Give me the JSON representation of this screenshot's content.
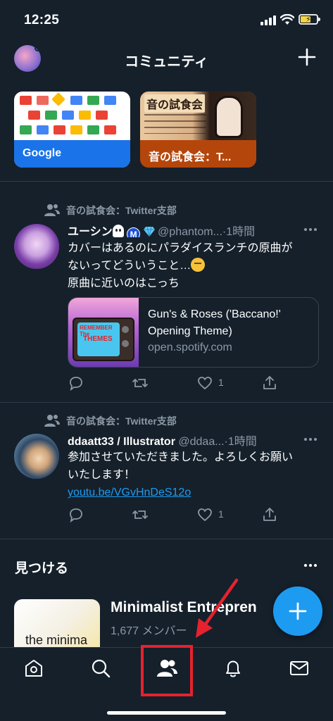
{
  "status_bar": {
    "time": "12:25"
  },
  "header": {
    "title": "コミュニティ"
  },
  "communities": [
    {
      "label": "Google"
    },
    {
      "label": "音の試食会：T...",
      "art_text": "音の試食会"
    }
  ],
  "tweets": [
    {
      "context": "音の試食会：Twitter支部",
      "name": "ユーシン",
      "verified_letter": "M",
      "handle": "@phantom...",
      "sep": "·",
      "time": "1時間",
      "text_line1": "カバーはあるのにパラダイスランチの原曲が",
      "text_line2": "ないってどういうこと…",
      "text_line3": "原曲に近いのはこっち",
      "card": {
        "title": "Gun's & Roses ('Baccano!' Opening Theme)",
        "domain": "open.spotify.com",
        "thumb_line1": "REMEMBER The",
        "thumb_line2": "THEMES"
      },
      "actions": {
        "likes": "1"
      }
    },
    {
      "context": "音の試食会：Twitter支部",
      "name": "ddaatt33 / Illustrator",
      "handle": "@ddaa...",
      "sep": "·",
      "time": "1時間",
      "text_line1": "参加させていただきました。よろしくお願い",
      "text_line2": "いたします！",
      "link": "youtu.be/VGvHnDeS12o",
      "actions": {
        "likes": "1"
      }
    }
  ],
  "discover": {
    "heading": "見つける",
    "item": {
      "name": "Minimalist Entrepren",
      "members": "1,677 メンバー",
      "thumb_text": "the minima"
    }
  },
  "colors": {
    "background": "#15202b",
    "accent": "#1d9bf0",
    "annotation": "#e5222e"
  },
  "tab_bar": {
    "tabs": [
      "home-icon",
      "search-icon",
      "communities-icon",
      "notifications-icon",
      "messages-icon"
    ],
    "active": "communities-icon"
  }
}
